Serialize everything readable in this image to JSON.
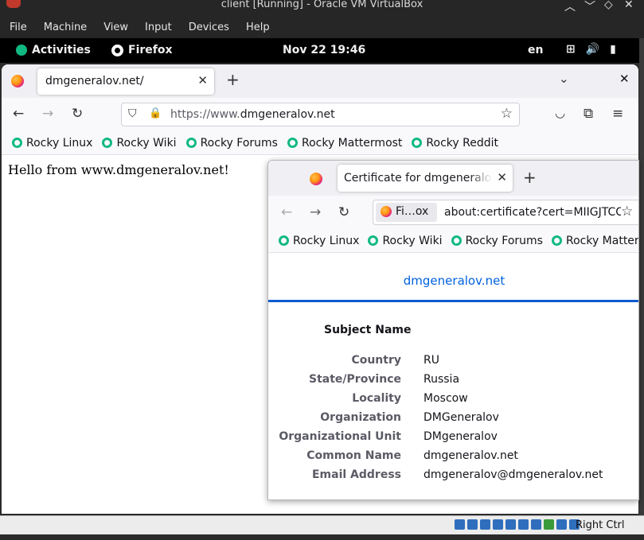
{
  "host_window": {
    "title": "client [Running] - Oracle VM VirtualBox",
    "menu": [
      "File",
      "Machine",
      "View",
      "Input",
      "Devices",
      "Help"
    ],
    "status_hostkey": "Right Ctrl"
  },
  "gnome_panel": {
    "activities": "Activities",
    "app": "Firefox",
    "clock": "Nov 22  19:46",
    "lang": "en"
  },
  "main_browser": {
    "tab_title": "dmgeneralov.net/",
    "url_prefix": "https://www.",
    "url_domain": "dmgeneralov.net",
    "bookmarks": [
      "Rocky Linux",
      "Rocky Wiki",
      "Rocky Forums",
      "Rocky Mattermost",
      "Rocky Reddit"
    ],
    "page_text": "Hello from www.dmgeneralov.net!"
  },
  "cert_window": {
    "tab_title": "Certificate for dmgeneralov.net",
    "identity_label": "Fi…ox",
    "url": "about:certificate?cert=MIIGJTCC",
    "bookmarks": [
      "Rocky Linux",
      "Rocky Wiki",
      "Rocky Forums",
      "Rocky Mattermost"
    ],
    "header": "dmgeneralov.net",
    "section_title": "Subject Name",
    "fields": [
      {
        "label": "Country",
        "value": "RU"
      },
      {
        "label": "State/Province",
        "value": "Russia"
      },
      {
        "label": "Locality",
        "value": "Moscow"
      },
      {
        "label": "Organization",
        "value": "DMGeneralov"
      },
      {
        "label": "Organizational Unit",
        "value": "DMgeneralov"
      },
      {
        "label": "Common Name",
        "value": "dmgeneralov.net"
      },
      {
        "label": "Email Address",
        "value": "dmgeneralov@dmgeneralov.net"
      }
    ]
  },
  "colors": {
    "accent_link": "#0061e0",
    "cert_underline": "#0a5bd0",
    "rocky_green": "#10b981"
  }
}
